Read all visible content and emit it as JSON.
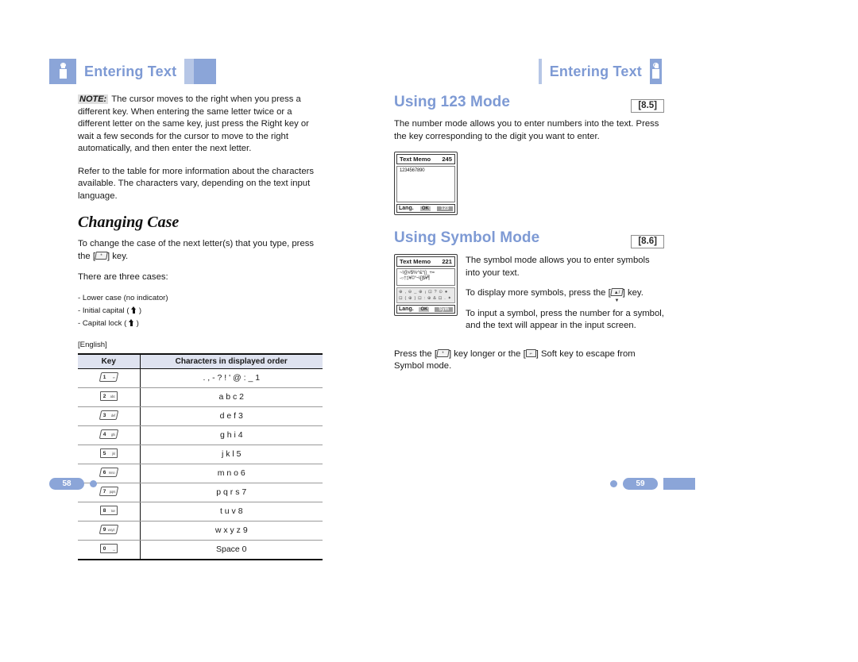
{
  "document": {
    "header_left": {
      "title": "Entering Text",
      "icon": "hand-press-icon"
    },
    "header_right": {
      "title": "Entering Text",
      "icon": "hand-press-icon"
    },
    "footer_left": {
      "page": "58"
    },
    "footer_right": {
      "page": "59"
    },
    "accent_color": "#8ba5d8",
    "heading_color": "#7e9ad4"
  },
  "left_column": {
    "note": {
      "tag": "NOTE:",
      "text": "The cursor moves to the right when you press a different key. When entering the same letter twice or a different letter on the same key, just press the Right key or wait a few seconds for the cursor to move to the right automatically, and then enter the next letter."
    },
    "intro": "Refer to the table for more information about the characters available. The characters vary, depending on the text input language.",
    "section": {
      "title": "Changing Case"
    },
    "para1_before": "To change the case of the next letter(s) that you type, press the [",
    "para1_key": "*",
    "para1_after": "] key.",
    "para2": "There are three cases:",
    "cases": [
      {
        "label": "- Lower case (no indicator)",
        "icon": "none"
      },
      {
        "label": "- Initial capital (",
        "icon": "arrow-up-icon",
        "after": ")"
      },
      {
        "label": "- Capital lock (",
        "icon": "arrow-up-icon",
        "after": ")"
      }
    ],
    "language_tag": "[English]",
    "key_table": {
      "columns": [
        "Key",
        "Characters in displayed order"
      ],
      "rows": [
        {
          "key_num": "1",
          "key_sub": "∞",
          "chars": ". , - ? ! ' @ : _ 1"
        },
        {
          "key_num": "2",
          "key_sub": "abc",
          "chars": "a  b  c  2"
        },
        {
          "key_num": "3",
          "key_sub": "def",
          "chars": "d  e  f  3"
        },
        {
          "key_num": "4",
          "key_sub": "ghi",
          "chars": "g  h  i  4"
        },
        {
          "key_num": "5",
          "key_sub": "jkl",
          "chars": "j  k  l  5"
        },
        {
          "key_num": "6",
          "key_sub": "mno",
          "chars": "m  n  o  6"
        },
        {
          "key_num": "7",
          "key_sub": "pqrs",
          "chars": "p  q  r  s  7"
        },
        {
          "key_num": "8",
          "key_sub": "tuv",
          "chars": "t  u  v  8"
        },
        {
          "key_num": "9",
          "key_sub": "wxyz",
          "chars": "w  x  y  z  9"
        },
        {
          "key_num": "0",
          "key_sub": "␣",
          "chars": "Space  0"
        }
      ]
    }
  },
  "right_column": {
    "section_123": {
      "title": "Using 123 Mode",
      "ref": "[8.5]",
      "body": "The number mode allows you to enter numbers into the text. Press the key corresponding to the digit you want to enter.",
      "screen": {
        "title": "Text Memo",
        "counter": "245",
        "content": "1234567890",
        "softkey_left": "Lang.",
        "softkey_center": "OK",
        "softkey_right": "123"
      }
    },
    "section_symbol": {
      "title": "Using Symbol Mode",
      "ref": "[8.6]",
      "screen": {
        "title": "Text Memo",
        "counter": "221",
        "content_line1": "~!@#$%^&*()_+=",
        "content_line2": "-○†‡¥©°¬\\[]$¥¶",
        "grid_line1": "⊕ , ⊖ _ ⊕ ¡ ⊡ ? ⊙ ●",
        "grid_line2": "⊡ ( ⊕ ) ⊡ : ⊕ & ⊡ . ✦",
        "softkey_left": "Lang.",
        "softkey_center": "OK",
        "softkey_right": "Sym"
      },
      "para1": "The symbol mode allows you to enter symbols into your text.",
      "para2_before": "To display more symbols, press the [",
      "para2_key": "▲/▼",
      "para2_after": "] key.",
      "para3": "To input a symbol, press the number for a symbol, and the text will appear in the input screen.",
      "para4_before": "Press the [",
      "para4_key1": "*",
      "para4_mid": "] key longer or the [",
      "para4_key2": "⌐",
      "para4_after": "] Soft key to escape from Symbol mode."
    }
  }
}
